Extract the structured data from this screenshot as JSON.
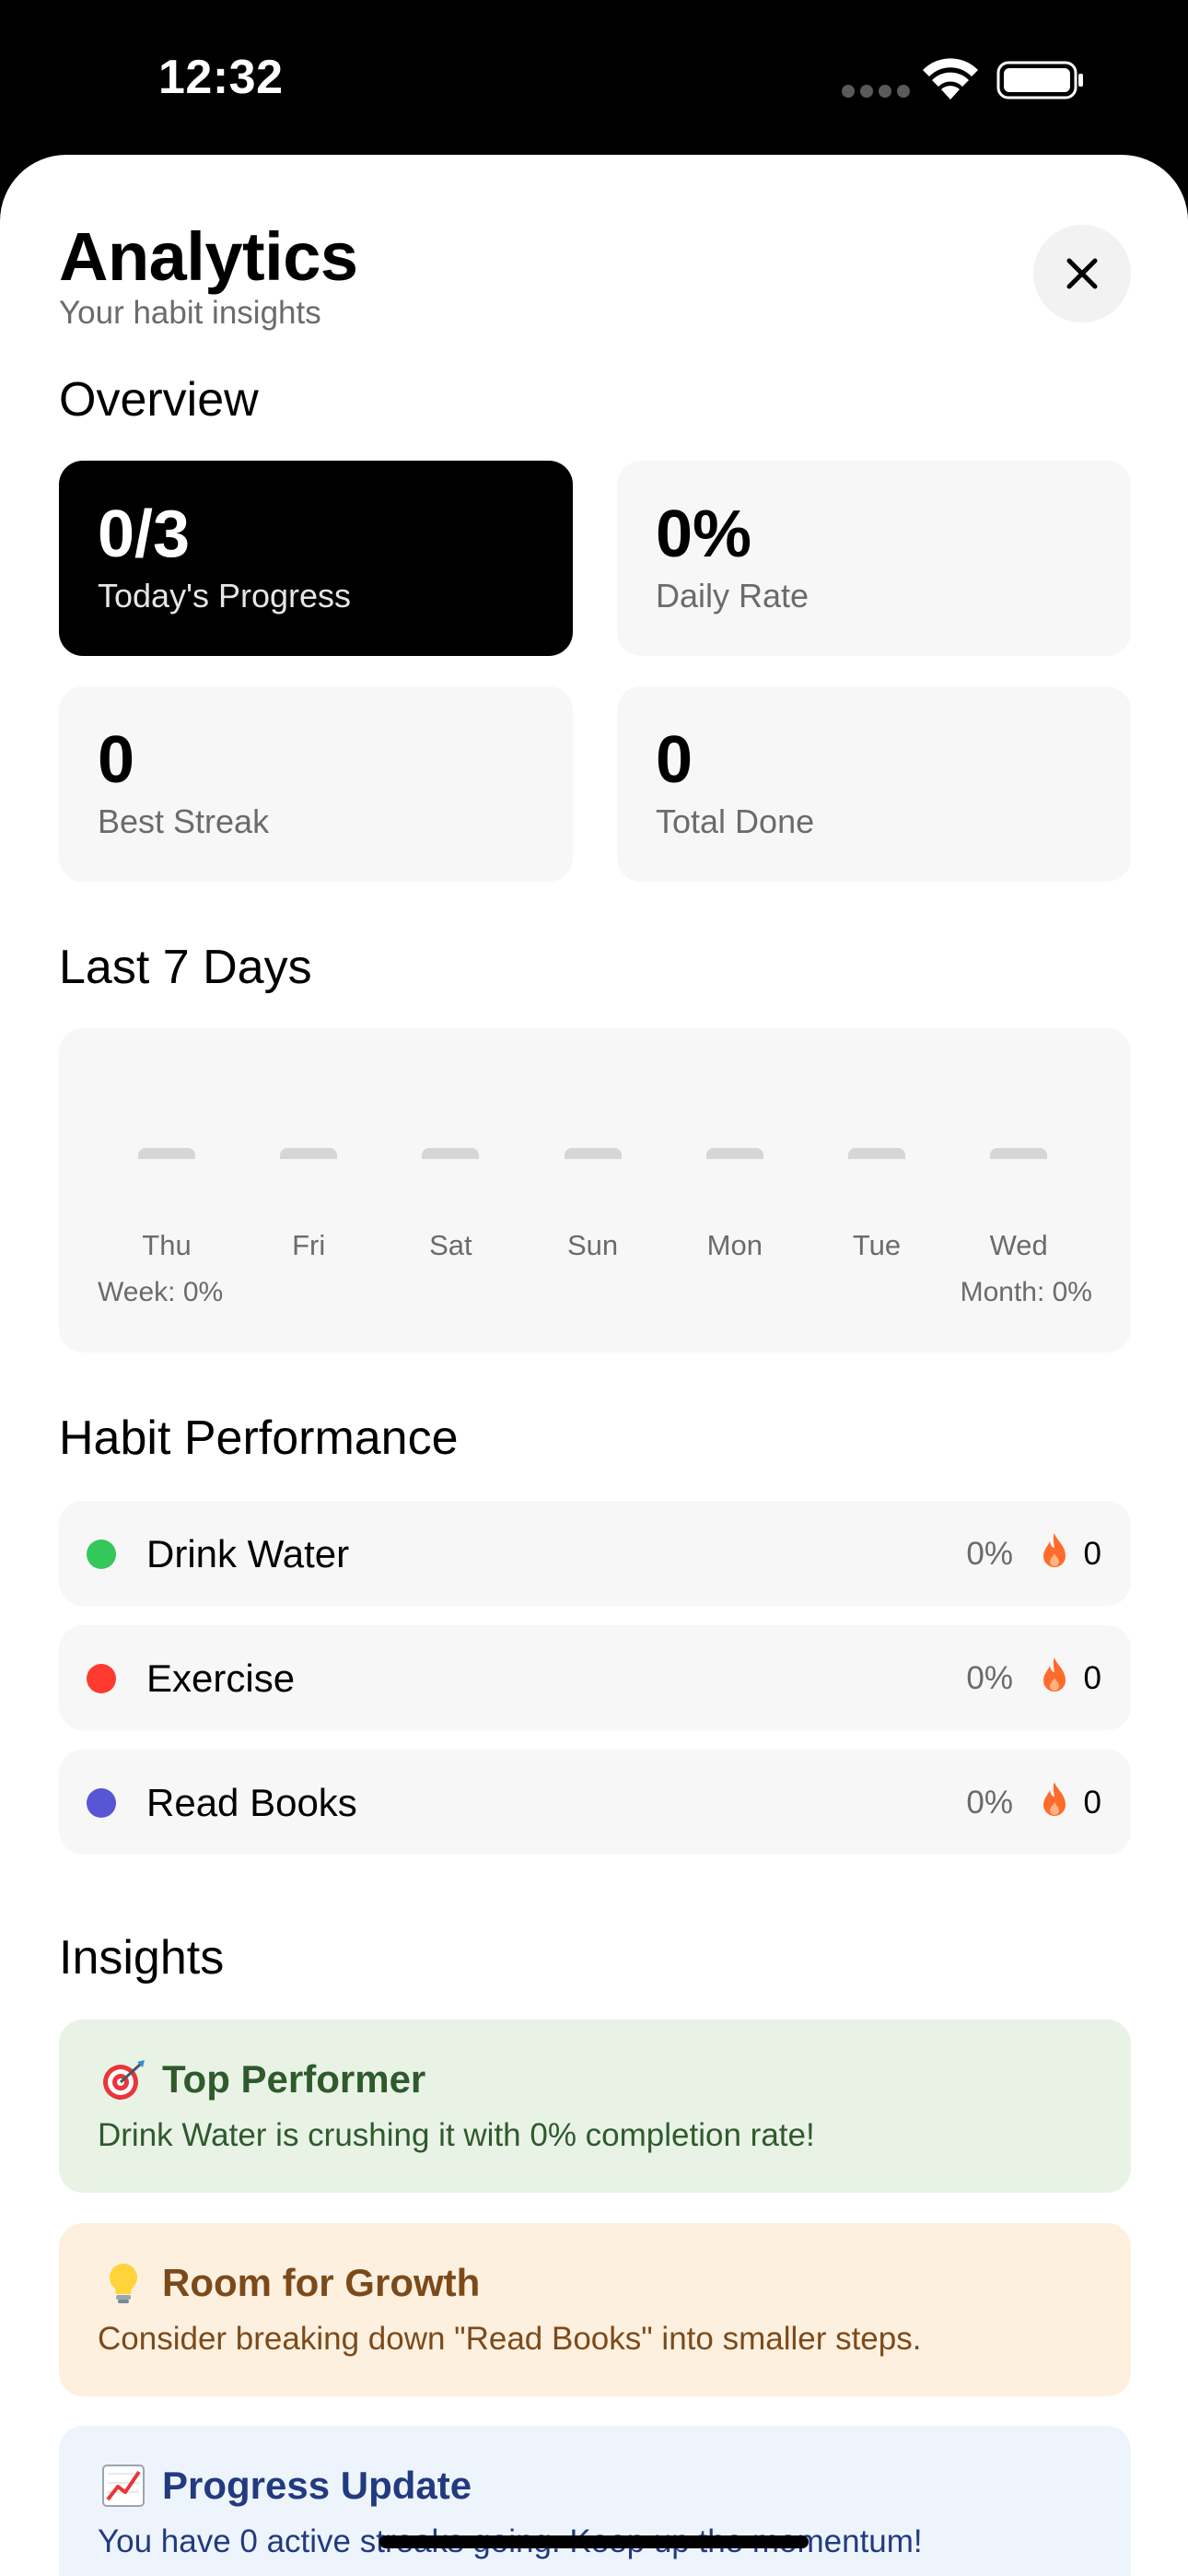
{
  "status_bar": {
    "time": "12:32"
  },
  "header": {
    "title": "Analytics",
    "subtitle": "Your habit insights"
  },
  "overview": {
    "title": "Overview",
    "cards": [
      {
        "value": "0/3",
        "label": "Today's Progress"
      },
      {
        "value": "0%",
        "label": "Daily Rate"
      },
      {
        "value": "0",
        "label": "Best Streak"
      },
      {
        "value": "0",
        "label": "Total Done"
      }
    ]
  },
  "last7": {
    "title": "Last 7 Days",
    "week_label": "Week: 0%",
    "month_label": "Month: 0%"
  },
  "chart_data": {
    "type": "bar",
    "categories": [
      "Thu",
      "Fri",
      "Sat",
      "Sun",
      "Mon",
      "Tue",
      "Wed"
    ],
    "values": [
      0,
      0,
      0,
      0,
      0,
      0,
      0
    ],
    "title": "Last 7 Days",
    "xlabel": "",
    "ylabel": ""
  },
  "performance": {
    "title": "Habit Performance",
    "habits": [
      {
        "name": "Drink Water",
        "rate": "0%",
        "streak": "0",
        "color": "#34c759"
      },
      {
        "name": "Exercise",
        "rate": "0%",
        "streak": "0",
        "color": "#ff3b30"
      },
      {
        "name": "Read Books",
        "rate": "0%",
        "streak": "0",
        "color": "#5856d6"
      }
    ]
  },
  "insights": {
    "title": "Insights",
    "items": [
      {
        "icon": "target-icon",
        "title": "Top Performer",
        "text": "Drink Water is crushing it with 0% completion rate!",
        "bg": "#e8f3e6",
        "color": "#2f5a2c"
      },
      {
        "icon": "lightbulb-icon",
        "title": "Room for Growth",
        "text": "Consider breaking down \"Read Books\" into smaller steps.",
        "bg": "#fdf0df",
        "color": "#7c4a1a"
      },
      {
        "icon": "chart-up-icon",
        "title": "Progress Update",
        "text": "You have 0 active streaks going. Keep up the momentum!",
        "bg": "#eef4fc",
        "color": "#223a80"
      }
    ]
  },
  "colors": {
    "accent": "#000000",
    "card_bg": "#f7f7f7",
    "flame": "#ff6b2c"
  }
}
